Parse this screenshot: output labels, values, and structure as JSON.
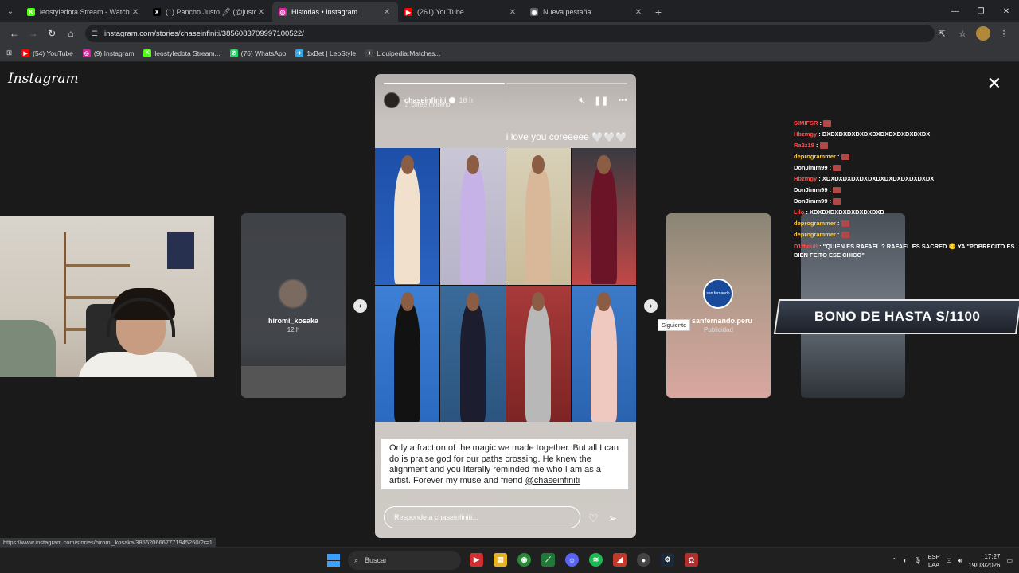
{
  "tabs": [
    {
      "title": "leostyledota Stream - Watch Li",
      "fav": "K",
      "color": "#53fc18"
    },
    {
      "title": "(1) Pancho Justo 🖊 (@justopa",
      "fav": "X",
      "color": "#000000"
    },
    {
      "title": "Historias • Instagram",
      "fav": "◎",
      "color": "#d6249f"
    },
    {
      "title": "(261) YouTube",
      "fav": "▶",
      "color": "#ff0000"
    },
    {
      "title": "Nueva pestaña",
      "fav": "◉",
      "color": "#5f6368"
    }
  ],
  "address": {
    "url": "instagram.com/stories/chaseinfiniti/3856083709997100522/"
  },
  "bookmarks": [
    {
      "label": "(54) YouTube",
      "fav": "▶",
      "color": "#ff0000"
    },
    {
      "label": "(9) Instagram",
      "fav": "◎",
      "color": "#d6249f"
    },
    {
      "label": "leostyledota Stream...",
      "fav": "K",
      "color": "#53fc18"
    },
    {
      "label": "(76) WhatsApp",
      "fav": "✆",
      "color": "#25d366"
    },
    {
      "label": "1xBet | LeoStyle",
      "fav": "✈",
      "color": "#2aabee"
    },
    {
      "label": "Liquipedia:Matches...",
      "fav": "✦",
      "color": "#444444"
    }
  ],
  "instagram": {
    "logo": "Instagram",
    "left_story": {
      "name": "hiromi_kosaka",
      "time": "12 h"
    },
    "right_story": {
      "name": "sanfernando.peru",
      "sub": "Publicidad",
      "avatar_text": "san fernando"
    },
    "tooltip": "Siguiente",
    "story": {
      "username": "chaseinfiniti",
      "time": "16 h",
      "collab": "coree.moreno",
      "caption": "i love you coreeeee 🤍🤍🤍",
      "text_before": "Only a fraction of the magic we made together. But all I can do is praise god for our paths crossing. He knew the alignment and you literally reminded me who I am as a artist. Forever my muse and friend ",
      "mention": "@chaseinfiniti",
      "reply_placeholder": "Responde a chaseinfiniti..."
    }
  },
  "chat": [
    {
      "user": "SIMIFSR",
      "color": "#ff4d4d",
      "msg": "",
      "emote": true
    },
    {
      "user": "Hbzmgy",
      "color": "#ff4d4d",
      "msg": "DXDXDXDXDXDXDXDXDXDXDXDXDX",
      "emote": false
    },
    {
      "user": "Ra2z18",
      "color": "#ff4d4d",
      "msg": "",
      "emote": true
    },
    {
      "user": "deprogrammer",
      "color": "#ffcc33",
      "msg": "",
      "emote": true
    },
    {
      "user": "DonJimm99",
      "color": "#ffffff",
      "msg": "",
      "emote": true
    },
    {
      "user": "Hbzmgy",
      "color": "#ff4d4d",
      "msg": "XDXDXDXDXDXDXDXDXDXDXDXDXDX",
      "emote": false
    },
    {
      "user": "DonJimm99",
      "color": "#ffffff",
      "msg": "",
      "emote": true
    },
    {
      "user": "DonJimm99",
      "color": "#ffffff",
      "msg": "",
      "emote": true
    },
    {
      "user": "Lilo",
      "color": "#ff4d4d",
      "msg": "XDXDXDXDXDXDXDXDXD",
      "emote": false
    },
    {
      "user": "deprogrammer",
      "color": "#ffcc33",
      "msg": "",
      "emote": true
    },
    {
      "user": "deprogrammer",
      "color": "#ffcc33",
      "msg": "",
      "emote": true
    },
    {
      "user": "D1fficult",
      "color": "#ff4d4d",
      "msg": "\"QUIEN ES RAFAEL ? RAFAEL ES SACRED 😏 YA \"POBRECITO ES BIEN FEITO ESE CHICO\"",
      "emote": false
    }
  ],
  "promo": {
    "text": "BONO DE HASTA S/1100"
  },
  "status_url": "https://www.instagram.com/stories/hiromi_kosaka/3856206667771945260/?r=1",
  "taskbar": {
    "search": "Buscar",
    "lang_top": "ESP",
    "lang_bottom": "LAA",
    "time": "17:27",
    "date": "19/03/2026"
  }
}
